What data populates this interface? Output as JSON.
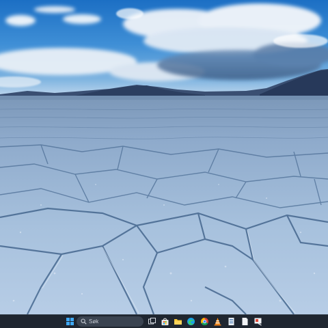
{
  "desktop": {
    "wallpaper": "bonneville-salt-flats-landscape"
  },
  "taskbar": {
    "background": "#1f2630",
    "search": {
      "label": "Søk",
      "icon": "search-icon"
    },
    "items": [
      {
        "name": "start-button",
        "icon": "windows-logo-icon"
      },
      {
        "name": "task-view-button",
        "icon": "task-view-icon"
      },
      {
        "name": "store-button",
        "icon": "store-bag-icon"
      },
      {
        "name": "file-explorer-button",
        "icon": "folder-icon"
      },
      {
        "name": "edge-button",
        "icon": "edge-browser-icon"
      },
      {
        "name": "chrome-button",
        "icon": "chrome-browser-icon"
      },
      {
        "name": "vlc-button",
        "icon": "vlc-cone-icon"
      },
      {
        "name": "document-app-button",
        "icon": "document-icon"
      },
      {
        "name": "notepad-button",
        "icon": "notepad-icon"
      },
      {
        "name": "paint-app-button",
        "icon": "paint-app-icon"
      }
    ]
  }
}
